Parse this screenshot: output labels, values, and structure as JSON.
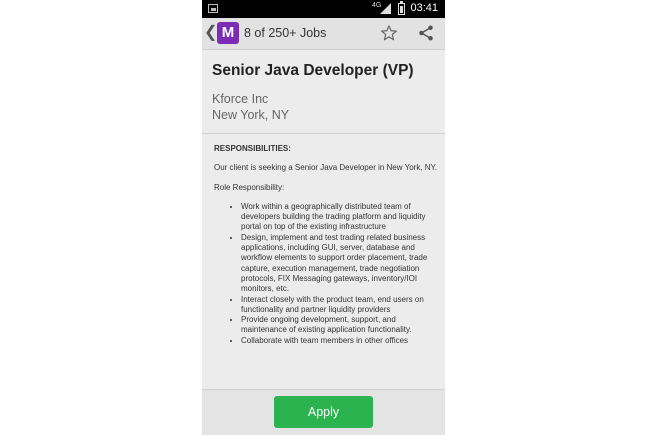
{
  "status_bar": {
    "network": "4G",
    "time": "03:41"
  },
  "action_bar": {
    "logo_letter": "M",
    "title": "8 of 250+ Jobs"
  },
  "job": {
    "title": "Senior Java Developer (VP)",
    "company": "Kforce Inc",
    "location": "New York, NY"
  },
  "description": {
    "heading": "RESPONSIBILITIES:",
    "intro": "Our client is seeking a Senior Java Developer in New York, NY.",
    "role_label": "Role Responsibility:",
    "bullets": [
      "Work within a geographically distributed team of developers building the trading platform and liquidity portal on top of the existing infrastructure",
      "Design, implement and test trading related business applications, including GUI, server, database and workflow elements to support order placement, trade capture, execution management, trade negotiation protocols, FIX Messaging gateways, inventory/IOI monitors, etc.",
      "Interact closely with the product team, end users on functionality and partner liquidity providers",
      "Provide ongoing development, support, and maintenance of existing application functionality.",
      "Collaborate with team members in other offices"
    ]
  },
  "footer": {
    "apply_label": "Apply"
  }
}
